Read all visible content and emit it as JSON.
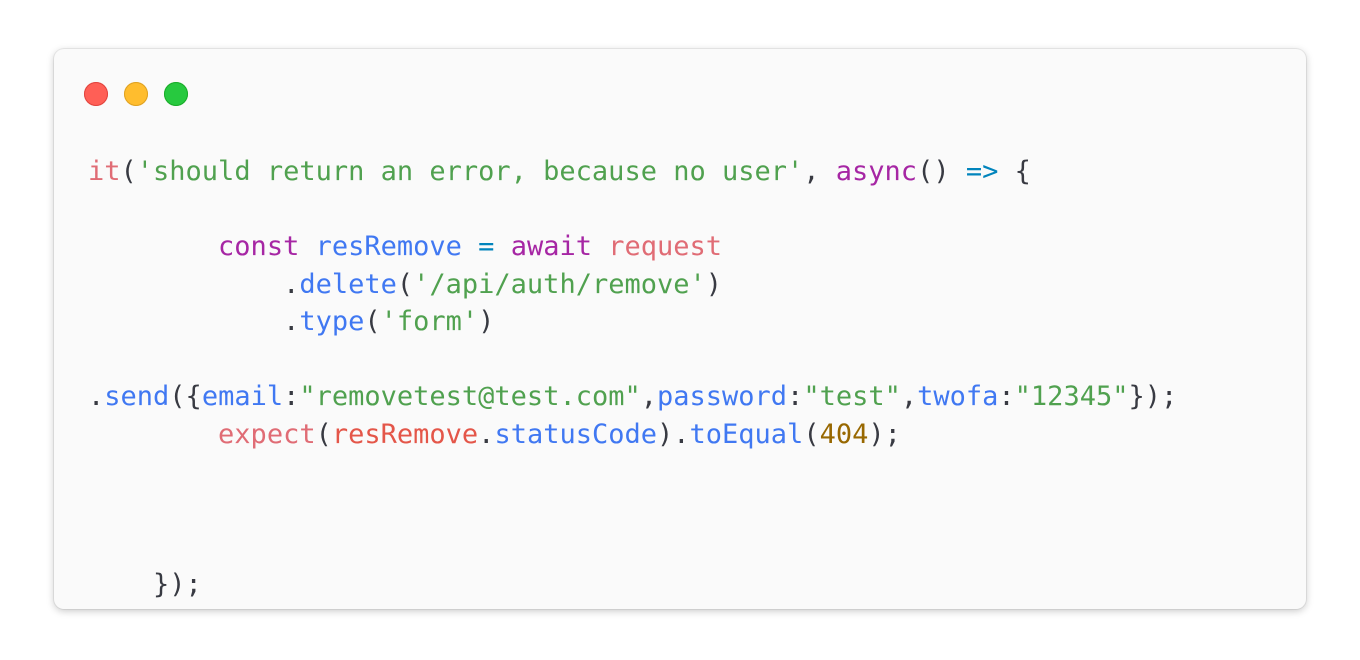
{
  "colors": {
    "window_bg": "#fafafa",
    "dot_close": "#ff5f56",
    "dot_minimize": "#ffbd2e",
    "dot_maximize": "#27c93f",
    "string": "#50a14f",
    "keyword": "#a626a4",
    "function": "#e06c75",
    "variable": "#4078f2",
    "number": "#986801",
    "plain": "#383a42"
  },
  "code_lines": [
    [
      {
        "t": "it",
        "c": "fnr"
      },
      {
        "t": "(",
        "c": "plain"
      },
      {
        "t": "'should return an error, because no user'",
        "c": "str"
      },
      {
        "t": ", ",
        "c": "plain"
      },
      {
        "t": "async",
        "c": "kw"
      },
      {
        "t": "() ",
        "c": "plain"
      },
      {
        "t": "=>",
        "c": "op"
      },
      {
        "t": " {",
        "c": "plain"
      }
    ],
    [],
    [
      {
        "t": "        ",
        "c": "plain"
      },
      {
        "t": "const",
        "c": "kw"
      },
      {
        "t": " ",
        "c": "plain"
      },
      {
        "t": "resRemove",
        "c": "var"
      },
      {
        "t": " ",
        "c": "plain"
      },
      {
        "t": "=",
        "c": "op"
      },
      {
        "t": " ",
        "c": "plain"
      },
      {
        "t": "await",
        "c": "kw"
      },
      {
        "t": " ",
        "c": "plain"
      },
      {
        "t": "request",
        "c": "fnr"
      }
    ],
    [
      {
        "t": "            .",
        "c": "plain"
      },
      {
        "t": "delete",
        "c": "prop"
      },
      {
        "t": "(",
        "c": "plain"
      },
      {
        "t": "'/api/auth/remove'",
        "c": "str"
      },
      {
        "t": ")",
        "c": "plain"
      }
    ],
    [
      {
        "t": "            .",
        "c": "plain"
      },
      {
        "t": "type",
        "c": "prop"
      },
      {
        "t": "(",
        "c": "plain"
      },
      {
        "t": "'form'",
        "c": "str"
      },
      {
        "t": ")",
        "c": "plain"
      }
    ],
    [],
    [
      {
        "t": ".",
        "c": "plain"
      },
      {
        "t": "send",
        "c": "prop"
      },
      {
        "t": "({",
        "c": "plain"
      },
      {
        "t": "email",
        "c": "prop"
      },
      {
        "t": ":",
        "c": "plain"
      },
      {
        "t": "\"removetest@test.com\"",
        "c": "str"
      },
      {
        "t": ",",
        "c": "plain"
      },
      {
        "t": "password",
        "c": "prop"
      },
      {
        "t": ":",
        "c": "plain"
      },
      {
        "t": "\"test\"",
        "c": "str"
      },
      {
        "t": ",",
        "c": "plain"
      },
      {
        "t": "twofa",
        "c": "prop"
      },
      {
        "t": ":",
        "c": "plain"
      },
      {
        "t": "\"12345\"",
        "c": "str"
      },
      {
        "t": "});",
        "c": "plain"
      }
    ],
    [
      {
        "t": "        ",
        "c": "plain"
      },
      {
        "t": "expect",
        "c": "fnr"
      },
      {
        "t": "(",
        "c": "plain"
      },
      {
        "t": "resRemove",
        "c": "fn"
      },
      {
        "t": ".",
        "c": "plain"
      },
      {
        "t": "statusCode",
        "c": "prop"
      },
      {
        "t": ").",
        "c": "plain"
      },
      {
        "t": "toEqual",
        "c": "prop"
      },
      {
        "t": "(",
        "c": "plain"
      },
      {
        "t": "404",
        "c": "num"
      },
      {
        "t": ");",
        "c": "plain"
      }
    ],
    [],
    [],
    [],
    [
      {
        "t": "    });",
        "c": "plain"
      }
    ]
  ]
}
